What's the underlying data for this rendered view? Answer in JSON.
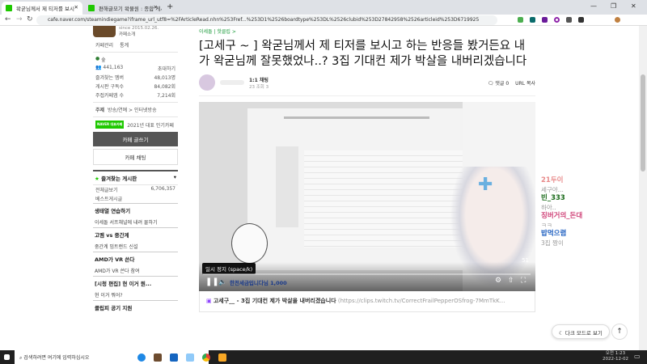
{
  "browser": {
    "tabs": [
      {
        "label": "왁굳님께서 제 티저를 보시"
      },
      {
        "label": "편해글모기 왁물원 : 종합 게시"
      }
    ],
    "url": "cafe.naver.com/steamindiegame?iframe_url_utf8=%2FArticleRead.nhn%253Fref...%253D1%2526boardtype%253DL%2526clubid%253D27842958%2526articleid%253D6719925"
  },
  "sidebar": {
    "since": "since 2015.02.26.",
    "cafe_intro": "카페소개",
    "manage": "카페관리",
    "stats": "통계",
    "level": "숲",
    "members": "441,163",
    "invite": "초대하기",
    "fav_label": "즐겨찾는 멤버",
    "fav_value": "48,013명",
    "sub_label": "게시판 구독수",
    "sub_value": "84,082회",
    "visit_label": "주접카페앱 수",
    "visit_value": "7,214회",
    "topic_label": "주제",
    "topic_value": "방송/연예 > 인터넷방송",
    "badge": "NAVER 대표카페",
    "badge_text": "2021년 대표 인기카페",
    "write": "카페 글쓰기",
    "chat": "카페 채팅",
    "fav_boards": "즐겨찾는 게시판",
    "all_posts": "전체글보기",
    "all_count": "6,706,357",
    "best": "베스트게시글",
    "groups": [
      {
        "head": "생태열 연습하기",
        "item": "이세돌 서프채널에 내려 물하기"
      },
      {
        "head": "고멤 vs 중간계",
        "item": "중간계 밈트랜드 신설"
      },
      {
        "head": "AMD가 VR 쓴다",
        "item": "AMD가 VR 쓴다 참여"
      },
      {
        "head": "[시청 편집] 현 이거 뭔...",
        "item": "현 이거 뭐어?"
      },
      {
        "head": "클립피 공기 지원",
        "item": ""
      }
    ]
  },
  "article": {
    "breadcrumb": "이세돌 | 핫클립 >",
    "title": "[고세구 ~ ] 왁굳님께서 제 티저를 보시고 하는 반응들 봤거든요 내가 왁굳님께 잘못했었나..? 3집 기대컨 제가 박살을 내버리겠습니다",
    "chat_btn": "1:1 채팅",
    "meta": "23  조회 3",
    "comments": "댓글 0",
    "url_copy": "URL 복사"
  },
  "video": {
    "tooltip": "일시 정지 (space/k)",
    "counter": "51",
    "donation": "한전세금입니다님 1,000",
    "overlay_chat": [
      {
        "name": "21두이",
        "msg": "세구야...",
        "color": "#e88a8a"
      },
      {
        "name": "빈_333",
        "msg": "하아..",
        "color": "#1a6a1a"
      },
      {
        "name": "징버거의_돈대",
        "msg": "ㅋㅋ",
        "color": "#d0457a"
      },
      {
        "name": "밥먹으렴",
        "msg": "3집 짱이",
        "color": "#1e5fc0"
      }
    ]
  },
  "clip": {
    "title": "고세구__ - 3집 기대컨 제가 박살을 내버리겠습니다",
    "link": "(https://clips.twitch.tv/CorrectFrailPepperOSfrog-7MmTkK..."
  },
  "floating": {
    "dark_mode": "다크 모드로 보기"
  },
  "taskbar": {
    "search": "검색하려면 여기에 입력하십시오",
    "time": "오전 1:23",
    "date": "2022-12-02"
  }
}
